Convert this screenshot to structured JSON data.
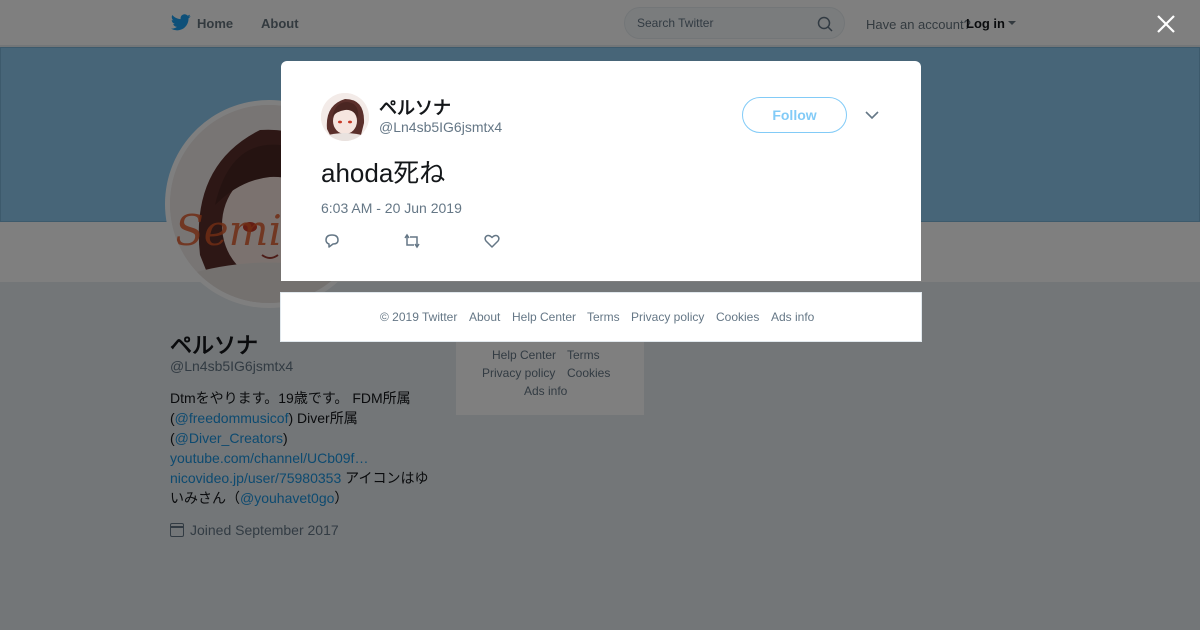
{
  "nav": {
    "home": "Home",
    "about": "About",
    "search_placeholder": "Search Twitter",
    "have_account": "Have an account?",
    "login": "Log in"
  },
  "profile": {
    "name": "ペルソナ",
    "handle": "@Ln4sb5IG6jsmtx4",
    "bio": {
      "t1": "Dtmをやります。19歳です。 FDM所属",
      "t2a": "(",
      "l1": "@freedommusicof",
      "t2b": ") Diver所属",
      "t3a": "(",
      "l2": "@Diver_Creators",
      "t3b": ")",
      "l3": "youtube.com/channel/UCb09f…",
      "l4": "nicovideo.jp/user/75980353",
      "t4": " アイコンはゆ",
      "t5a": "いみさん（",
      "l5": "@youhavet0go",
      "t5b": "）"
    },
    "joined": "Joined September 2017"
  },
  "side_footer": {
    "help": "Help Center",
    "terms": "Terms",
    "privacy": "Privacy policy",
    "cookies": "Cookies",
    "ads": "Ads info"
  },
  "tweet": {
    "name": "ペルソナ",
    "handle": "@Ln4sb5IG6jsmtx4",
    "follow": "Follow",
    "text": "ahoda死ね",
    "timestamp": "6:03 AM - 20 Jun 2019"
  },
  "footer": {
    "copyright": "© 2019 Twitter",
    "about": "About",
    "help": "Help Center",
    "terms": "Terms",
    "privacy": "Privacy policy",
    "cookies": "Cookies",
    "ads": "Ads info"
  },
  "icons": [
    "twitter-bird-icon",
    "search-icon",
    "calendar-icon",
    "close-icon",
    "chevron-down-icon",
    "reply-icon",
    "retweet-icon",
    "like-icon"
  ],
  "colors": {
    "brand": "#1da1f2",
    "banner": "#8fcbf0",
    "link": "#1b95e0"
  }
}
